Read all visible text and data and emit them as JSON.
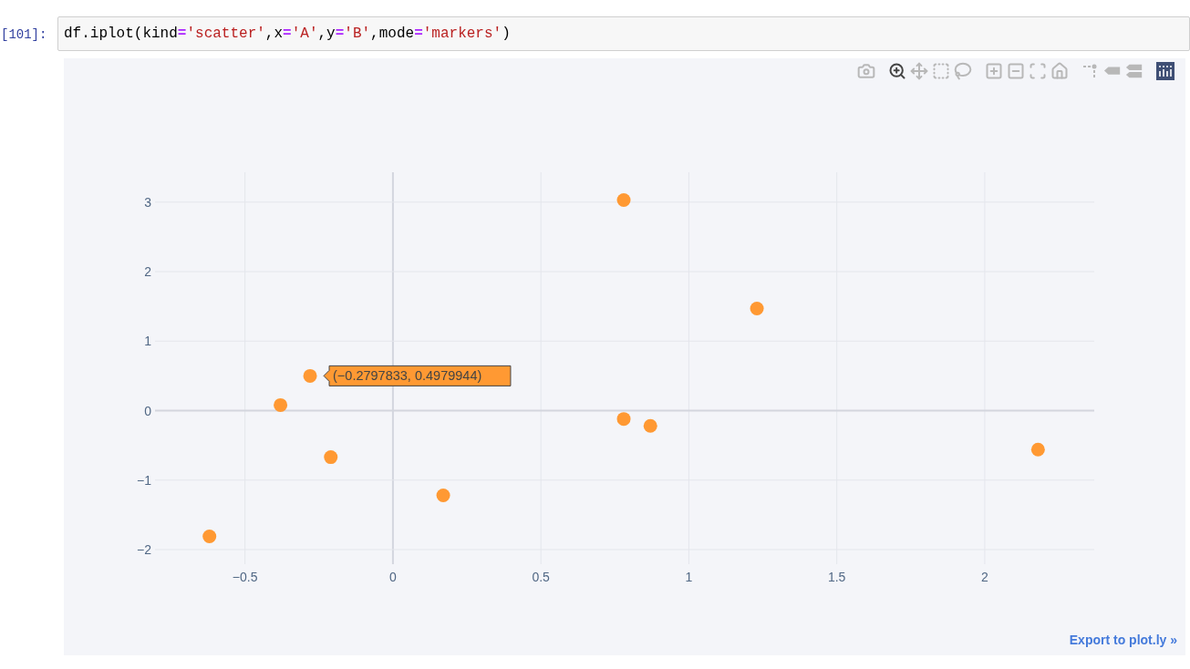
{
  "cell": {
    "prompt": "[101]:",
    "code": [
      {
        "kind": "plain",
        "text": "df.iplot(kind"
      },
      {
        "kind": "op",
        "text": "="
      },
      {
        "kind": "string",
        "text": "'scatter'"
      },
      {
        "kind": "plain",
        "text": ",x"
      },
      {
        "kind": "op",
        "text": "="
      },
      {
        "kind": "string",
        "text": "'A'"
      },
      {
        "kind": "plain",
        "text": ",y"
      },
      {
        "kind": "op",
        "text": "="
      },
      {
        "kind": "string",
        "text": "'B'"
      },
      {
        "kind": "plain",
        "text": ",mode"
      },
      {
        "kind": "op",
        "text": "="
      },
      {
        "kind": "string",
        "text": "'markers'"
      },
      {
        "kind": "plain",
        "text": ")"
      }
    ]
  },
  "plot": {
    "modebar": [
      {
        "selected": false
      },
      {
        "selected": true
      },
      {
        "selected": false
      },
      {
        "selected": false
      },
      {
        "selected": false
      },
      {
        "selected": false
      },
      {
        "selected": false
      },
      {
        "selected": false
      },
      {
        "selected": false
      },
      {
        "selected": false
      },
      {
        "selected": false
      },
      {
        "selected": false
      }
    ],
    "chart_data": {
      "type": "scatter",
      "grid": true,
      "xlim": [
        -0.804,
        2.37
      ],
      "ylim": [
        -2.21,
        3.43
      ],
      "xticks": [
        {
          "value": -0.5,
          "label": "−0.5"
        },
        {
          "value": 0,
          "label": "0"
        },
        {
          "value": 0.5,
          "label": "0.5"
        },
        {
          "value": 1,
          "label": "1"
        },
        {
          "value": 1.5,
          "label": "1.5"
        },
        {
          "value": 2,
          "label": "2"
        }
      ],
      "yticks": [
        {
          "value": -2,
          "label": "−2"
        },
        {
          "value": -1,
          "label": "−1"
        },
        {
          "value": 0,
          "label": "0"
        },
        {
          "value": 1,
          "label": "1"
        },
        {
          "value": 2,
          "label": "2"
        },
        {
          "value": 3,
          "label": "3"
        }
      ],
      "series": [
        {
          "color": "#ff9933",
          "x": [
            -0.62,
            -0.38,
            -0.28,
            -0.21,
            0.17,
            0.78,
            0.78,
            0.87,
            1.23,
            2.18
          ],
          "values": [
            -1.81,
            0.08,
            0.5,
            -0.67,
            -1.22,
            3.03,
            -0.12,
            -0.22,
            1.47,
            -0.56
          ]
        }
      ],
      "annotations": [
        {
          "x": -0.28,
          "y": 0.5,
          "text": "(−0.2797833, 0.4979944)"
        }
      ]
    },
    "export_link": "Export to plot.ly »"
  }
}
